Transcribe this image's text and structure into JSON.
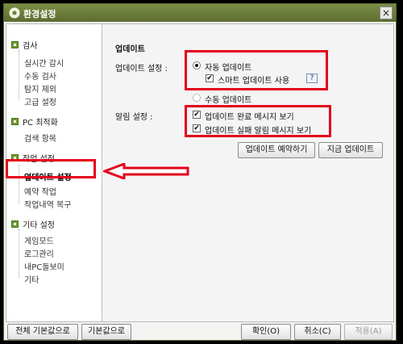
{
  "window": {
    "title": "환경설정",
    "close_glyph": "×"
  },
  "sidebar": {
    "groups": [
      {
        "label": "검사",
        "items": [
          "실시간 감시",
          "수동 검사",
          "탐지 제외",
          "고급 설정"
        ]
      },
      {
        "label": "PC 최적화",
        "items": [
          "검색 항목"
        ]
      },
      {
        "label": "작업 설정",
        "items": [
          "업데이트 설정",
          "예약 작업",
          "작업내역 복구"
        ]
      },
      {
        "label": "기타 설정",
        "items": [
          "게임모드",
          "로그관리",
          "내PC돌보미",
          "기타"
        ]
      }
    ],
    "selected": "업데이트 설정"
  },
  "main": {
    "section_title": "업데이트",
    "update_setting_label": "업데이트 설정 :",
    "auto_update": "자동 업데이트",
    "smart_update": "스마트 업데이트 사용",
    "help_glyph": "?",
    "manual_update": "수동 업데이트",
    "alarm_setting_label": "알림 설정 :",
    "notify_complete": "업데이트 완료 메시지 보기",
    "notify_fail": "업데이트 실패 알림 메시지 보기",
    "schedule_button": "업데이트 예약하기",
    "update_now_button": "지금 업데이트",
    "check_glyph": "✔"
  },
  "bottom": {
    "reset_all": "전체 기본값으로",
    "reset": "기본값으로",
    "ok": "확인(O)",
    "cancel": "취소(C)",
    "apply": "적용(A)"
  },
  "colors": {
    "highlight": "#e3001b",
    "titlebar": "#6b7d3a",
    "category_icon": "#6f9b2c"
  }
}
